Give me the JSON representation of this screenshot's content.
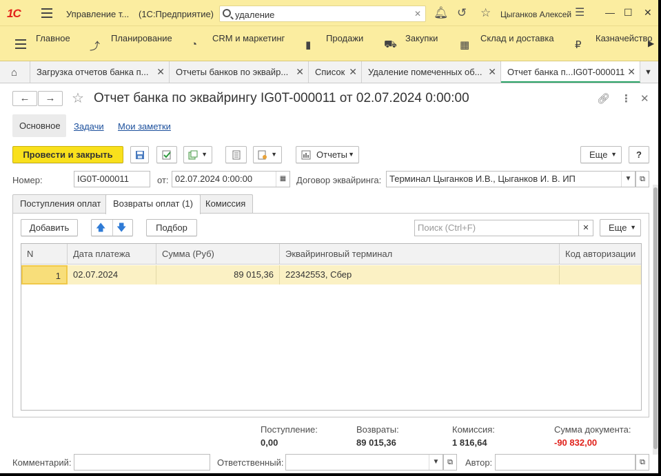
{
  "titlebar": {
    "logo": "1С",
    "app_title": "Управление т...",
    "app_sub": "(1С:Предприятие)",
    "search_value": "удаление",
    "user": "Цыганков Алексей"
  },
  "sections": [
    {
      "label": "Главное",
      "icon": "menu-icon"
    },
    {
      "label": "Планирование",
      "icon": "planning-icon"
    },
    {
      "label": "CRM и маркетинг",
      "icon": "crm-icon"
    },
    {
      "label": "Продажи",
      "icon": "bag-icon"
    },
    {
      "label": "Закупки",
      "icon": "cart-icon"
    },
    {
      "label": "Склад и доставка",
      "icon": "warehouse-icon"
    },
    {
      "label": "Казначейство",
      "icon": "ruble-icon"
    }
  ],
  "open_tabs": [
    {
      "label": "Загрузка отчетов банка п..."
    },
    {
      "label": "Отчеты банков по эквайр..."
    },
    {
      "label": "Список"
    },
    {
      "label": "Удаление помеченных об..."
    },
    {
      "label": "Отчет банка п...IG0T-000011",
      "active": true
    }
  ],
  "form": {
    "title": "Отчет банка по эквайрингу IG0T-000011 от 02.07.2024 0:00:00",
    "tabs": {
      "main": "Основное",
      "tasks": "Задачи",
      "notes": "Мои заметки"
    },
    "toolbar": {
      "post_close": "Провести и закрыть",
      "reports": "Отчеты",
      "more": "Еще",
      "help": "?"
    },
    "fields": {
      "number_label": "Номер:",
      "number_value": "IG0T-000011",
      "date_label": "от:",
      "date_value": "02.07.2024  0:00:00",
      "contract_label": "Договор эквайринга:",
      "contract_value": "Терминал Цыганков И.В., Цыганков И. В. ИП"
    },
    "inner_tabs": [
      "Поступления оплат",
      "Возвраты оплат (1)",
      "Комиссия"
    ],
    "table_toolbar": {
      "add": "Добавить",
      "pick": "Подбор",
      "search_placeholder": "Поиск (Ctrl+F)",
      "more": "Еще"
    },
    "table": {
      "columns": [
        "N",
        "Дата платежа",
        "Сумма (Руб)",
        "Эквайринговый терминал",
        "Код авторизации"
      ],
      "rows": [
        {
          "n": "1",
          "date": "02.07.2024",
          "sum": "89 015,36",
          "terminal": "22342553, Сбер",
          "auth": ""
        }
      ]
    },
    "totals": {
      "income_label": "Поступление:",
      "income_value": "0,00",
      "returns_label": "Возвраты:",
      "returns_value": "89 015,36",
      "commission_label": "Комиссия:",
      "commission_value": "1 816,64",
      "doc_sum_label": "Сумма документа:",
      "doc_sum_value": "-90 832,00",
      "doc_sum_color": "#e0201a"
    },
    "bottom": {
      "comment_label": "Комментарий:",
      "responsible_label": "Ответственный:",
      "author_label": "Автор:"
    }
  }
}
